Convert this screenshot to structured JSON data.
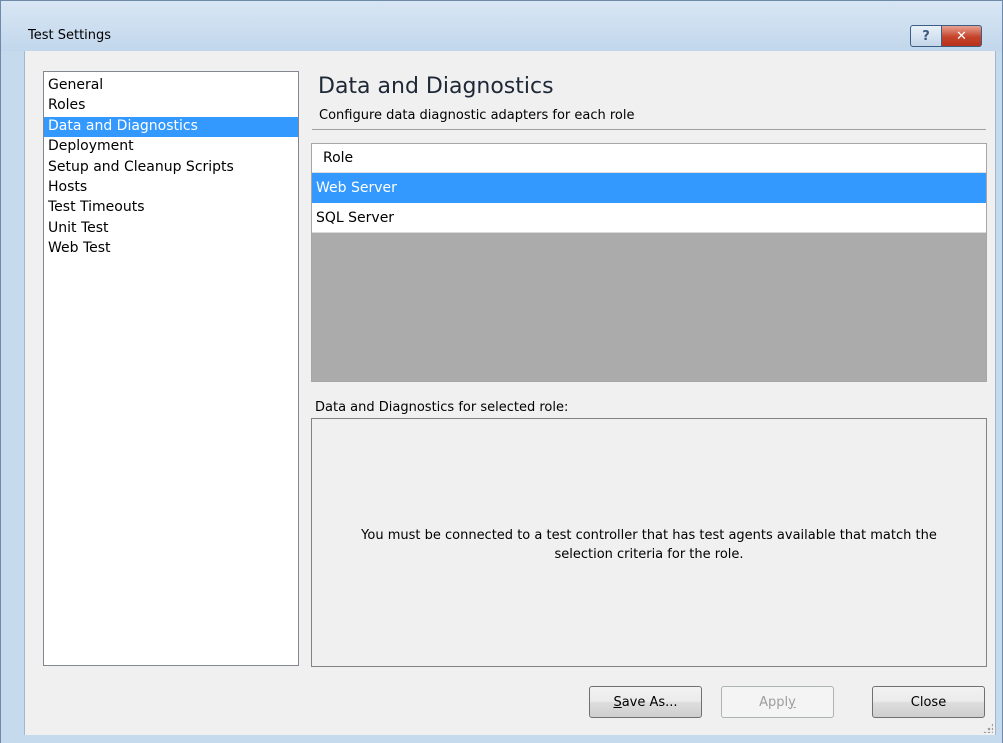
{
  "window": {
    "title": "Test Settings",
    "help_glyph": "?",
    "close_glyph": "✕"
  },
  "nav": {
    "items": [
      {
        "label": "General"
      },
      {
        "label": "Roles"
      },
      {
        "label": "Data and Diagnostics",
        "selected": true
      },
      {
        "label": "Deployment"
      },
      {
        "label": "Setup and Cleanup Scripts"
      },
      {
        "label": "Hosts"
      },
      {
        "label": "Test Timeouts"
      },
      {
        "label": "Unit Test"
      },
      {
        "label": "Web Test"
      }
    ]
  },
  "section": {
    "title": "Data and Diagnostics",
    "subtitle": "Configure data diagnostic adapters for each role"
  },
  "roles_grid": {
    "header": "Role",
    "rows": [
      {
        "label": "Web Server",
        "selected": true
      },
      {
        "label": "SQL Server",
        "selected": false
      }
    ]
  },
  "diagnostics": {
    "label": "Data and Diagnostics for selected role:",
    "message": "You must be connected to a test controller that has test agents available that match the selection criteria for the role."
  },
  "buttons": {
    "save_as": {
      "prefix": "",
      "mnemonic": "S",
      "rest": "ave As..."
    },
    "apply": {
      "prefix": "Appl",
      "mnemonic": "y",
      "rest": "",
      "disabled": true
    },
    "close": {
      "label": "Close"
    }
  },
  "colors": {
    "selection": "#3399ff",
    "client_bg": "#f0f0f0",
    "frame_bg": "#c6daee",
    "grid_empty_bg": "#ababab"
  }
}
